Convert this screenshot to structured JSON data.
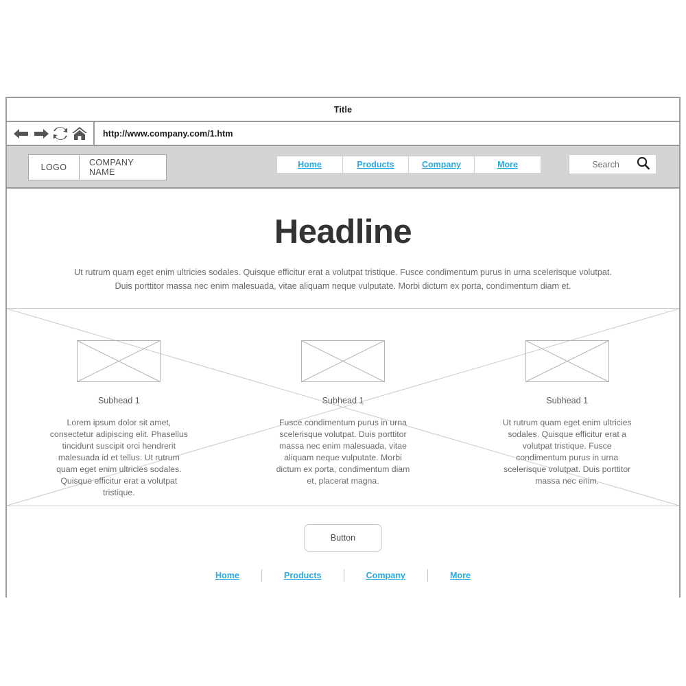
{
  "browser": {
    "title": "Title",
    "url": "http://www.company.com/1.htm",
    "icons": [
      {
        "name": "back-arrow-icon",
        "label": "Back"
      },
      {
        "name": "forward-arrow-icon",
        "label": "Forward"
      },
      {
        "name": "refresh-icon",
        "label": "Refresh"
      },
      {
        "name": "home-icon",
        "label": "Home"
      }
    ]
  },
  "header": {
    "logo_label": "LOGO",
    "company_label": "COMPANY NAME",
    "nav": [
      {
        "label": "Home"
      },
      {
        "label": "Products"
      },
      {
        "label": "Company"
      },
      {
        "label": "More"
      }
    ],
    "search": {
      "placeholder": "Search",
      "icon": "search-icon"
    }
  },
  "hero": {
    "headline": "Headline",
    "subtext": "Ut rutrum quam eget enim ultricies sodales. Quisque efficitur erat a volutpat tristique. Fusce condimentum purus in urna scelerisque volutpat. Duis porttitor massa nec enim malesuada, vitae aliquam neque vulputate. Morbi dictum ex porta, condimentum diam et."
  },
  "features": [
    {
      "image": "image-placeholder",
      "subhead": "Subhead 1",
      "body": "Lorem ipsum dolor sit amet, consectetur adipiscing elit. Phasellus tincidunt suscipit orci hendrerit malesuada id et tellus. Ut rutrum quam eget enim ultricies sodales. Quisque efficitur erat a volutpat tristique."
    },
    {
      "image": "image-placeholder",
      "subhead": "Subhead 1",
      "body": "Fusce condimentum purus in urna scelerisque volutpat. Duis porttitor massa nec enim malesuada, vitae aliquam neque vulputate. Morbi dictum ex porta, condimentum diam et, placerat magna."
    },
    {
      "image": "image-placeholder",
      "subhead": "Subhead 1",
      "body": "Ut rutrum quam eget enim ultricies sodales. Quisque efficitur erat a volutpat tristique. Fusce condimentum purus in urna scelerisque volutpat. Duis porttitor massa nec enim."
    }
  ],
  "footer": {
    "button_label": "Button",
    "nav": [
      {
        "label": "Home"
      },
      {
        "label": "Products"
      },
      {
        "label": "Company"
      },
      {
        "label": "More"
      }
    ]
  },
  "colors": {
    "link": "#29aae2",
    "header_band": "#d4d4d4",
    "frame_border": "#9b9b9b",
    "wire_line": "#c9c9c9",
    "body_text": "#6b6b6b",
    "headline_text": "#333333"
  }
}
